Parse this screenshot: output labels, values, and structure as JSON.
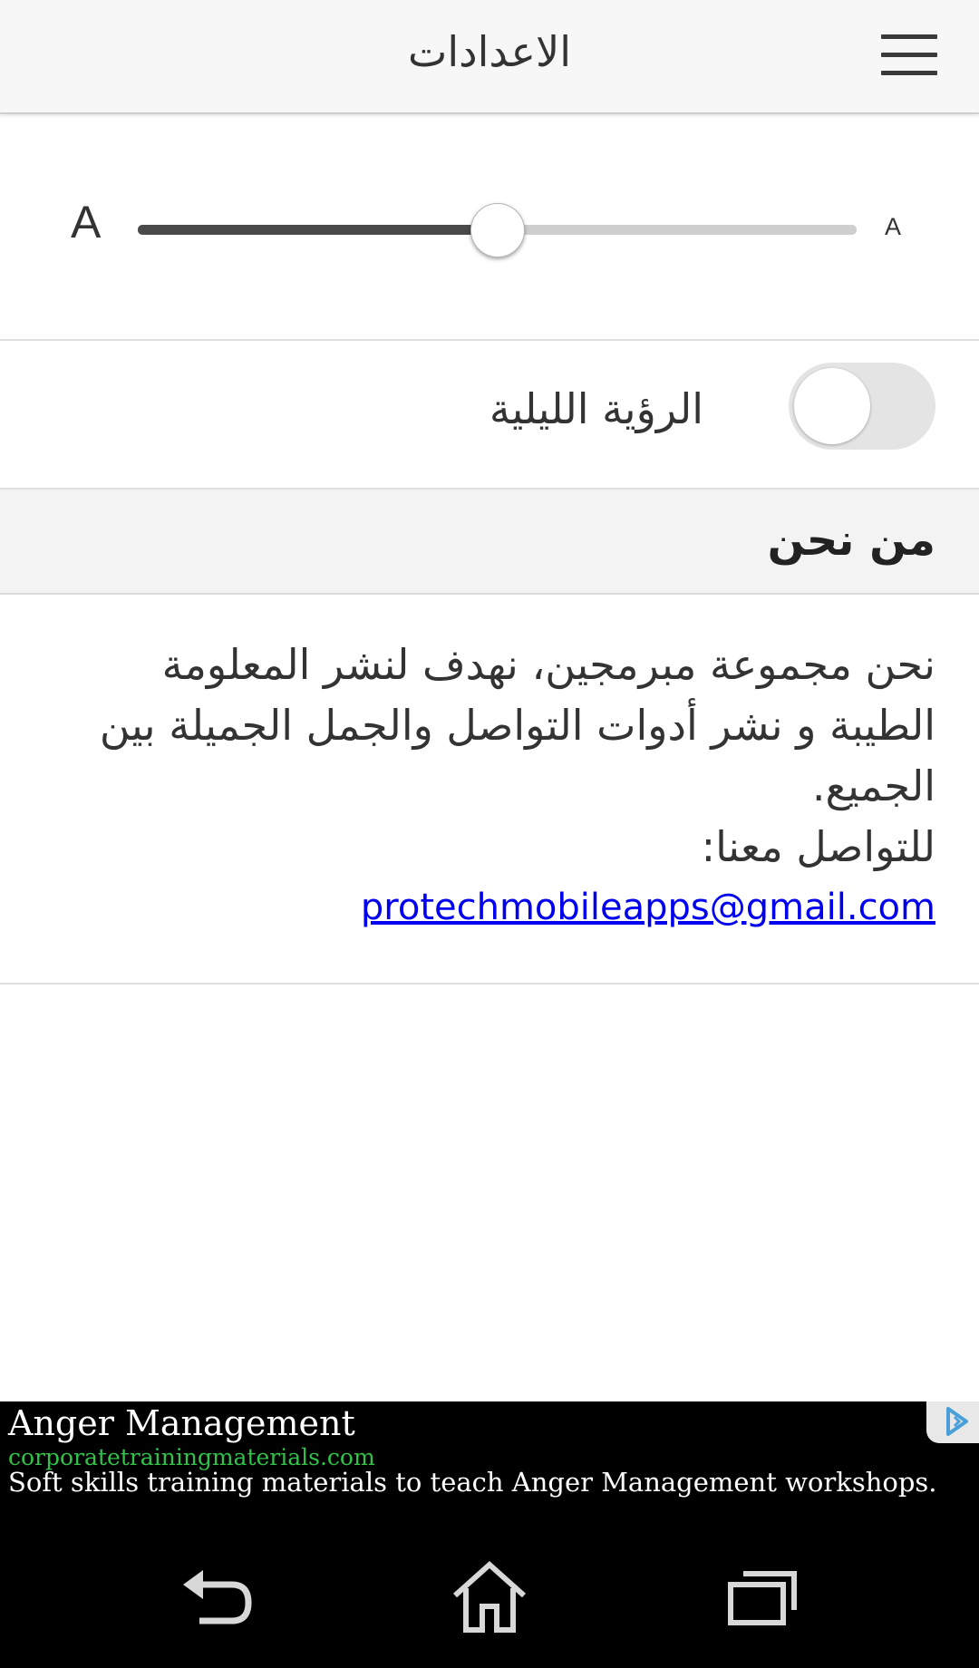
{
  "header": {
    "title": "الاعدادات",
    "menu_icon": "hamburger-menu-icon"
  },
  "font_size": {
    "large_label": "A",
    "small_label": "A",
    "slider_value": 0.5
  },
  "night_mode": {
    "label": "الرؤية الليلية",
    "enabled": false
  },
  "about": {
    "section_title": "من نحن",
    "description": "نحن مجموعة مبرمجين، نهدف لنشر المعلومة الطيبة و نشر أدوات التواصل والجمل الجميلة بين الجميع.",
    "contact_label": "للتواصل معنا:",
    "email": "protechmobileapps@gmail.com"
  },
  "ad": {
    "title": "Anger Management",
    "url": "corporatetrainingmaterials.com",
    "description": "Soft skills training materials to teach Anger Management workshops.",
    "choice_icon": "adchoices-icon",
    "url_color": "#31c24a"
  },
  "navbar": {
    "back_icon": "back-icon",
    "home_icon": "home-icon",
    "recents_icon": "recent-apps-icon"
  }
}
